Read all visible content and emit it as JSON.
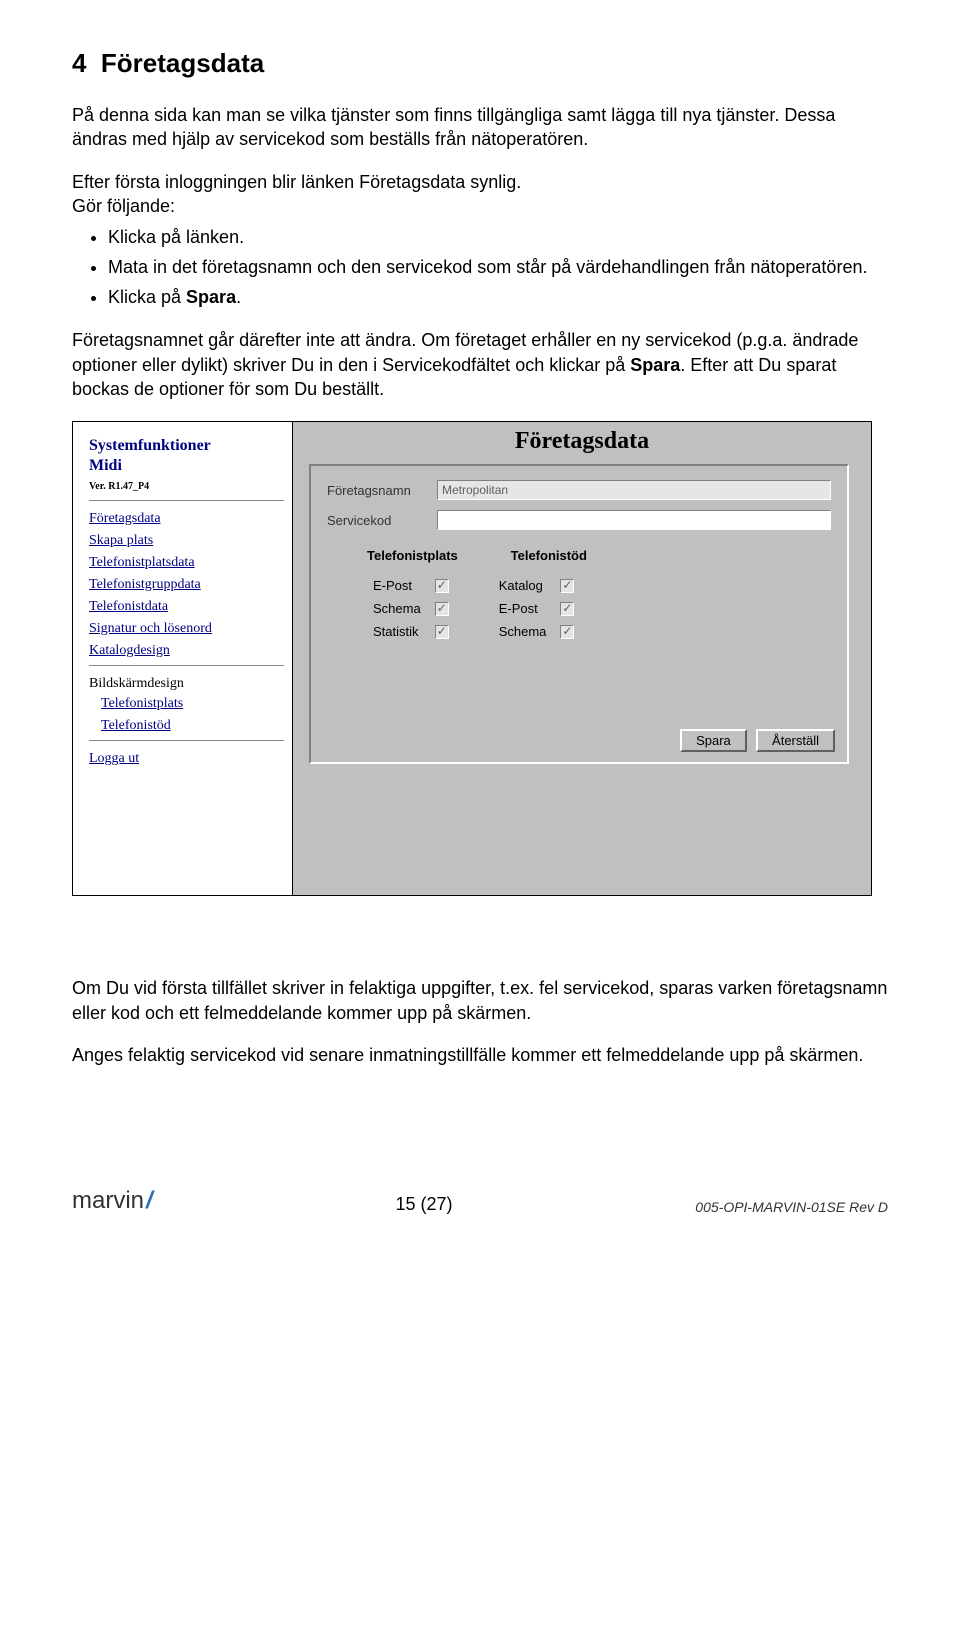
{
  "section": {
    "number": "4",
    "title": "Företagsdata"
  },
  "paragraphs": {
    "p1": "På denna sida kan man se vilka tjänster som finns tillgängliga samt lägga till nya tjänster. Dessa ändras med hjälp av servicekod som beställs från nätoperatören.",
    "p2": "Efter första inloggningen blir länken Företagsdata synlig.",
    "p2b": "Gör följande:",
    "bullets": [
      "Klicka på länken.",
      "Mata in det företagsnamn och den servicekod som står på värdehandlingen från nätoperatören.",
      "Klicka på "
    ],
    "bullet3_bold": "Spara",
    "bullet3_end": ".",
    "p3a": "Företagsnamnet går därefter inte att ändra. Om företaget erhåller en ny servicekod (p.g.a. ändrade optioner eller dylikt) skriver Du in den i Servicekodfältet och klickar på ",
    "p3bold": "Spara",
    "p3b": ". Efter att Du sparat bockas de optioner för som Du beställt.",
    "p4": "Om Du vid första tillfället skriver in felaktiga uppgifter, t.ex. fel servicekod, sparas varken företagsnamn eller kod och ett felmeddelande kommer upp på skärmen.",
    "p5": "Anges felaktig servicekod vid senare inmatningstillfälle kommer ett felmeddelande upp på skärmen."
  },
  "screenshot": {
    "sidebar": {
      "title_line1": "Systemfunktioner",
      "title_line2": "Midi",
      "version": "Ver. R1.47_P4",
      "links_top": [
        "Företagsdata",
        "Skapa plats",
        "Telefonistplatsdata",
        "Telefonistgruppdata",
        "Telefonistdata",
        "Signatur och lösenord",
        "Katalogdesign"
      ],
      "plain_label": "Bildskärmdesign",
      "links_mid": [
        "Telefonistplats",
        "Telefonistöd"
      ],
      "links_bottom": [
        "Logga ut"
      ]
    },
    "main": {
      "title": "Företagsdata",
      "company_label": "Företagsnamn",
      "company_value": "Metropolitan",
      "servicecode_label": "Servicekod",
      "servicecode_value": "",
      "group1_header": "Telefonistplats",
      "group2_header": "Telefonistöd",
      "rows": [
        {
          "l": "E-Post",
          "r": "Katalog"
        },
        {
          "l": "Schema",
          "r": "E-Post"
        },
        {
          "l": "Statistik",
          "r": "Schema"
        }
      ],
      "btn_save": "Spara",
      "btn_reset": "Återställ"
    }
  },
  "footer": {
    "logo_text": "marvin",
    "page_indicator": "15 (27)",
    "doc_id": "005-OPI-MARVIN-01SE Rev D"
  }
}
